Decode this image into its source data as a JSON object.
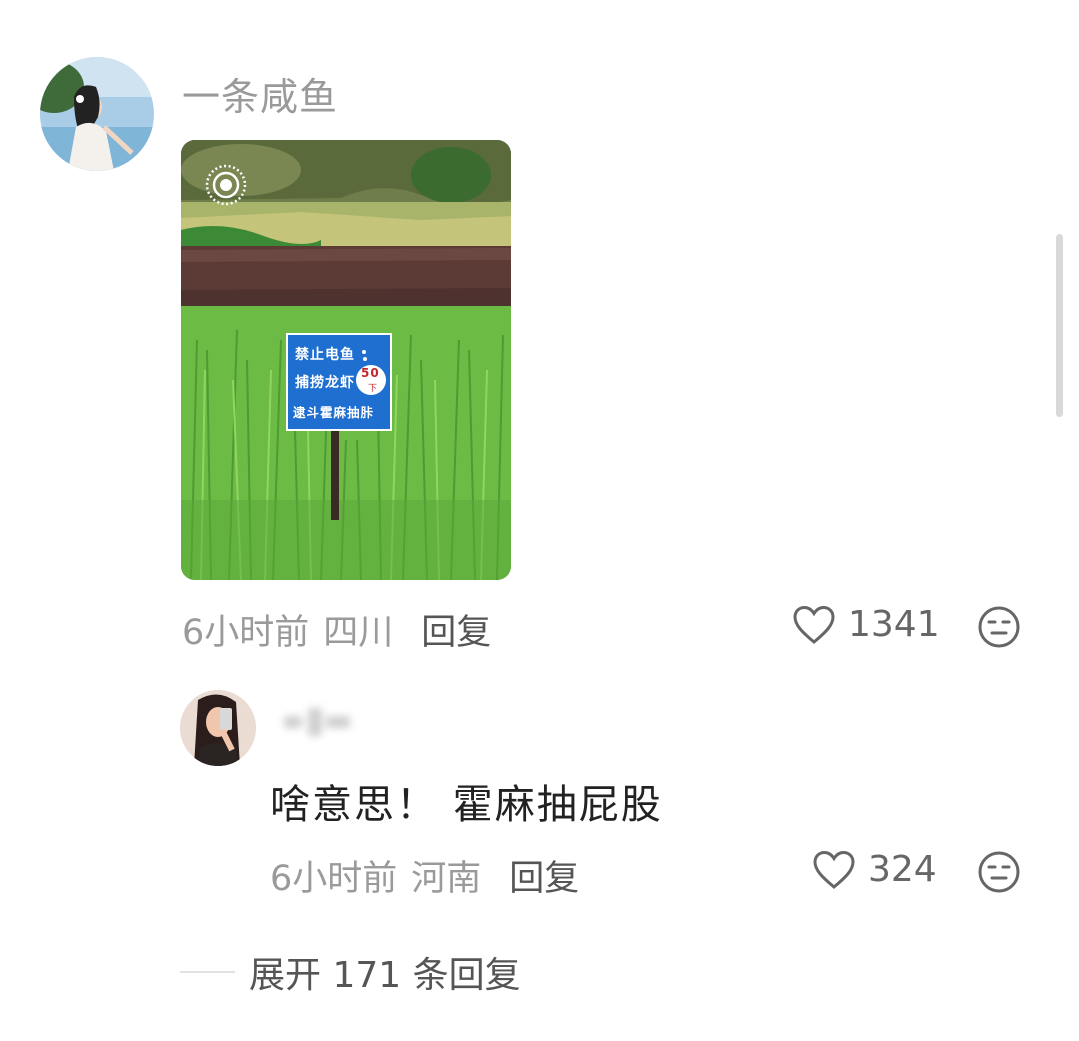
{
  "comment": {
    "username": "一条咸鱼",
    "time": "6小时前",
    "region": "四川",
    "reply_label": "回复",
    "likes": "1341",
    "photo": {
      "sign_lines": [
        "禁止电鱼",
        "捕捞龙虾",
        "逮斗霍麻抽胩"
      ],
      "sign_badge_number": "50",
      "sign_badge_suffix": "下",
      "badge_icon": "live-photo-icon"
    }
  },
  "reply": {
    "text": "啥意思！ 霍麻抽屁股",
    "time": "6小时前",
    "region": "河南",
    "reply_label": "回复",
    "likes": "324"
  },
  "expand": {
    "label": "展开 171 条回复"
  },
  "icons": {
    "like": "heart-outline-icon",
    "dislike": "meh-face-icon"
  },
  "colors": {
    "meta_gray": "#9a9a9a",
    "text_dark": "#222222",
    "sign_blue": "#1f6fd0"
  }
}
